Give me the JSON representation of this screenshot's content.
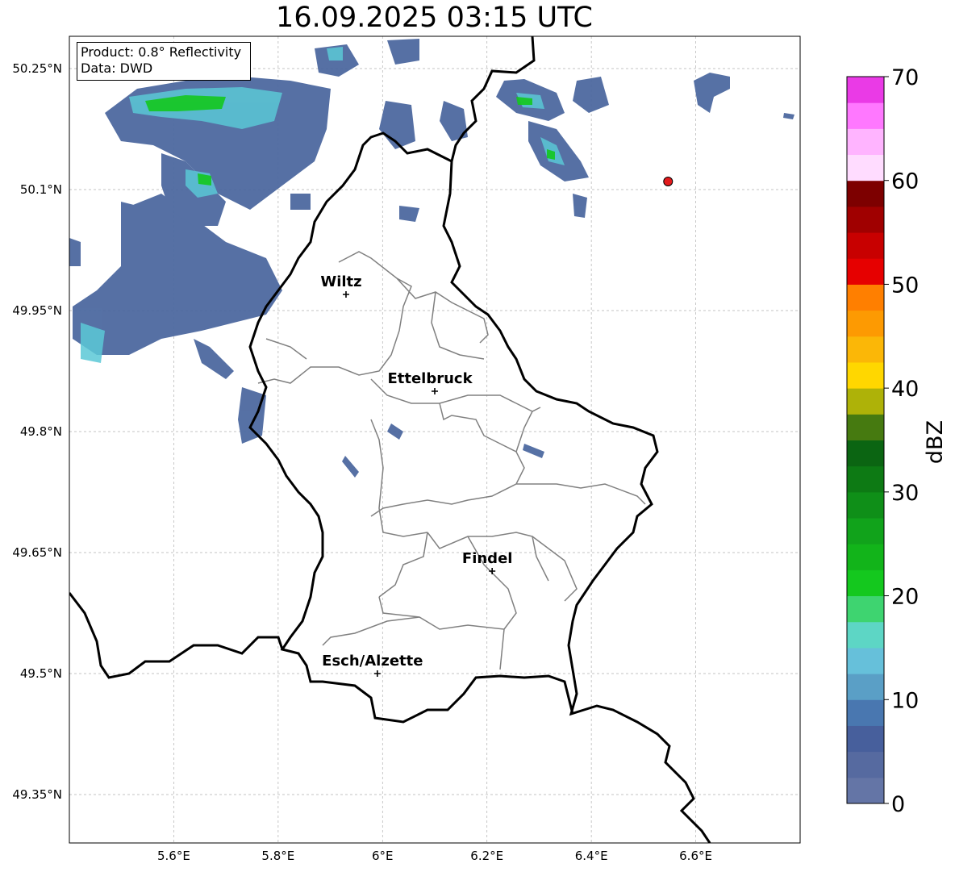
{
  "title": "16.09.2025 03:15 UTC",
  "info": {
    "product": "Product: 0.8° Reflectivity",
    "data": "Data: DWD"
  },
  "map": {
    "lon_range": [
      5.4,
      6.8
    ],
    "lat_range": [
      49.29,
      50.29
    ],
    "x_ticks": [
      {
        "value": 5.6,
        "label": "5.6°E"
      },
      {
        "value": 5.8,
        "label": "5.8°E"
      },
      {
        "value": 6.0,
        "label": "6°E"
      },
      {
        "value": 6.2,
        "label": "6.2°E"
      },
      {
        "value": 6.4,
        "label": "6.4°E"
      },
      {
        "value": 6.6,
        "label": "6.6°E"
      }
    ],
    "y_ticks": [
      {
        "value": 50.25,
        "label": "50.25°N"
      },
      {
        "value": 50.1,
        "label": "50.1°N"
      },
      {
        "value": 49.95,
        "label": "49.95°N"
      },
      {
        "value": 49.8,
        "label": "49.8°N"
      },
      {
        "value": 49.65,
        "label": "49.65°N"
      },
      {
        "value": 49.5,
        "label": "49.5°N"
      },
      {
        "value": 49.35,
        "label": "49.35°N"
      }
    ],
    "cities": [
      {
        "name": "Wiltz",
        "lon": 5.93,
        "lat": 49.97
      },
      {
        "name": "Ettelbruck",
        "lon": 6.1,
        "lat": 49.85
      },
      {
        "name": "Findel",
        "lon": 6.21,
        "lat": 49.627
      },
      {
        "name": "Esch/Alzette",
        "lon": 5.99,
        "lat": 49.5
      }
    ],
    "radar_site": {
      "lon": 6.547,
      "lat": 50.11,
      "color": "#e31a1c"
    }
  },
  "colorbar": {
    "label": "dBZ",
    "ticks": [
      "0",
      "10",
      "20",
      "30",
      "40",
      "50",
      "60",
      "70"
    ],
    "min": 0,
    "max": 70,
    "colors": [
      "#6475a6",
      "#566aa0",
      "#475f9c",
      "#4977b0",
      "#5a9fc6",
      "#66c0da",
      "#5dd6c5",
      "#3ed470",
      "#14c81e",
      "#12b41a",
      "#11a31b",
      "#0f8f18",
      "#0d7a14",
      "#0b6512",
      "#467a10",
      "#aeb208",
      "#ffd700",
      "#fbb707",
      "#fd9a02",
      "#ff7f00",
      "#e60000",
      "#c80000",
      "#a00000",
      "#7d0000",
      "#ffdcff",
      "#ffb4ff",
      "#ff78ff",
      "#ea3ae6"
    ]
  },
  "legend_colors": {
    "border": "#000000",
    "canton": "#808080",
    "grid": "#b0b0b0"
  }
}
